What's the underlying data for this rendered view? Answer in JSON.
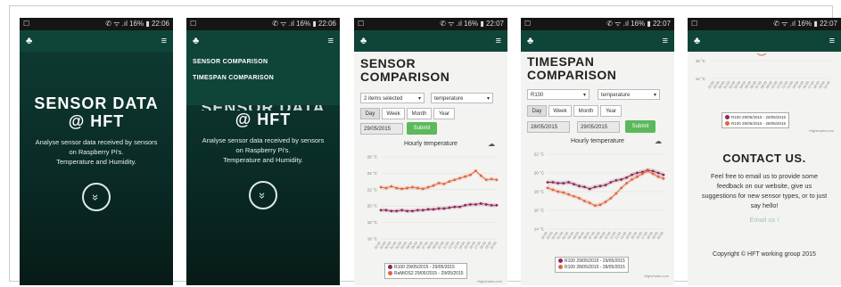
{
  "status": {
    "time1": "22:06",
    "time2": "22:06",
    "time3": "22:07",
    "time4": "22:07",
    "time5": "22:07",
    "icons": "✆ ᯤ .ıl 16% ▮"
  },
  "nav": {
    "logo": "♣",
    "menu": "≡"
  },
  "hero": {
    "title_line1": "SENSOR DATA",
    "title_line2": "@ HFT",
    "desc_line1": "Analyse sensor data received by sensors",
    "desc_line2": "on Raspberry Pi's.",
    "desc_line3": "Temperature and Humidity.",
    "scroll": "»"
  },
  "menu": {
    "item1": "SENSOR COMPARISON",
    "item2": "TIMESPAN COMPARISON",
    "partial_title": "SENSOR DATA"
  },
  "sensor": {
    "title_line1": "SENSOR",
    "title_line2": "COMPARISON",
    "select_items": "2 items selected",
    "select_type": "temperature",
    "tabs": [
      "Day",
      "Week",
      "Month",
      "Year"
    ],
    "date": "29/05/2015",
    "submit": "Submit",
    "chart_title": "Hourly temperature",
    "legend1": "R100 29/05/2015 - 29/05/2015",
    "legend2": "RaMiOS2 29/05/2015 - 29/05/2015",
    "credits": "Highcharts.com"
  },
  "timespan": {
    "title_line1": "TIMESPAN",
    "title_line2": "COMPARISON",
    "select_sensor": "R100",
    "select_type": "temperature",
    "tabs": [
      "Day",
      "Week",
      "Month",
      "Year"
    ],
    "date1": "28/05/2015",
    "date2": "29/05/2015",
    "submit": "Submit",
    "chart_title": "Hourly temperature",
    "legend1": "R100 29/05/2015 - 29/05/2015",
    "legend2": "R100 28/05/2015 - 28/05/2015",
    "credits": "Highcharts.com"
  },
  "contact": {
    "top_label1": "16 °C",
    "top_label2": "14 °C",
    "legend1": "R100 29/05/2015 - 29/05/2015",
    "legend2": "R100 28/05/2015 - 28/05/2015",
    "credits": "Highcharts.com",
    "title": "CONTACT US.",
    "text_line1": "Feel free to email us to provide some",
    "text_line2": "feedback on our website, give us",
    "text_line3": "suggestions for new sensor types, or to just",
    "text_line4": "say hello!",
    "link": "Email us !",
    "copyright": "Copyright © HFT working group 2015"
  },
  "chart_data": [
    {
      "type": "line",
      "title": "Hourly temperature",
      "ylabels": [
        "16 °C",
        "18 °C",
        "20 °C",
        "22 °C",
        "24 °C",
        "26 °C"
      ],
      "ylim": [
        16,
        26
      ],
      "x": [
        "22:00",
        "23:00",
        "00:00",
        "01:00",
        "02:00",
        "03:00",
        "04:00",
        "05:00",
        "06:00",
        "07:00",
        "08:00",
        "09:00",
        "10:00",
        "11:00",
        "12:00",
        "13:00",
        "14:00",
        "15:00",
        "16:00",
        "17:00",
        "18:00",
        "19:00",
        "20:00"
      ],
      "series": [
        {
          "name": "R100 29/05/2015 - 29/05/2015",
          "color": "#8b2a58",
          "values": [
            19.5,
            19.5,
            19.4,
            19.4,
            19.5,
            19.4,
            19.4,
            19.5,
            19.5,
            19.6,
            19.6,
            19.7,
            19.7,
            19.8,
            19.9,
            19.9,
            20.1,
            20.2,
            20.2,
            20.3,
            20.2,
            20.1,
            20.1
          ]
        },
        {
          "name": "RaMiOS2 29/05/2015 - 29/05/2015",
          "color": "#e0663a",
          "values": [
            22.3,
            22.2,
            22.4,
            22.2,
            22.1,
            22.2,
            22.3,
            22.2,
            22.1,
            22.3,
            22.5,
            22.8,
            22.7,
            23.0,
            23.2,
            23.4,
            23.6,
            23.8,
            24.3,
            23.7,
            23.2,
            23.3,
            23.2
          ]
        }
      ]
    },
    {
      "type": "line",
      "title": "Hourly temperature",
      "ylabels": [
        "14 °C",
        "16 °C",
        "18 °C",
        "20 °C",
        "22 °C"
      ],
      "ylim": [
        14,
        22
      ],
      "x": [
        "22:00",
        "23:00",
        "00:00",
        "01:00",
        "02:00",
        "03:00",
        "04:00",
        "05:00",
        "06:00",
        "07:00",
        "08:00",
        "09:00",
        "10:00",
        "11:00",
        "12:00",
        "13:00",
        "14:00",
        "15:00",
        "16:00",
        "17:00",
        "18:00",
        "19:00",
        "20:00"
      ],
      "series": [
        {
          "name": "R100 29/05/2015 - 29/05/2015",
          "color": "#8b2a58",
          "values": [
            19.0,
            19.0,
            18.9,
            18.9,
            19.0,
            18.8,
            18.6,
            18.5,
            18.3,
            18.5,
            18.6,
            18.7,
            19.0,
            19.2,
            19.3,
            19.5,
            19.8,
            20.0,
            20.1,
            20.3,
            20.2,
            20.0,
            19.8
          ]
        },
        {
          "name": "R100 28/05/2015 - 28/05/2015",
          "color": "#e0663a",
          "values": [
            18.4,
            18.2,
            18.0,
            17.9,
            17.7,
            17.5,
            17.3,
            17.0,
            16.8,
            16.5,
            16.6,
            16.9,
            17.3,
            17.8,
            18.4,
            18.9,
            19.3,
            19.6,
            19.9,
            20.2,
            19.9,
            19.6,
            19.4
          ]
        }
      ]
    }
  ]
}
